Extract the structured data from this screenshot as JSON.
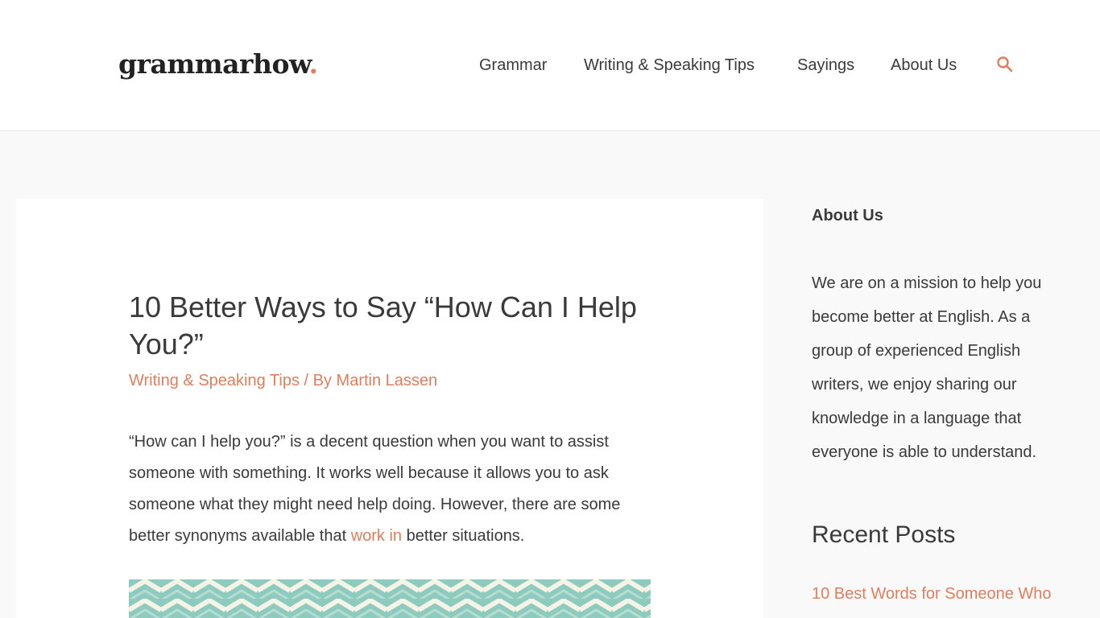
{
  "site": {
    "logo_text": "grammarhow",
    "logo_dot": "."
  },
  "nav": {
    "items": [
      {
        "label": "Grammar"
      },
      {
        "label": "Writing & Speaking Tips"
      },
      {
        "label": "Sayings"
      },
      {
        "label": "About Us"
      }
    ],
    "search_icon": "search-icon"
  },
  "article": {
    "title": "10 Better Ways to Say “How Can I Help You?”",
    "category": "Writing & Speaking Tips",
    "separator_by": " / By ",
    "author": "Martin Lassen",
    "body_before_link": "“How can I help you?” is a decent question when you want to assist someone with something. It works well because it allows you to ask someone what they might need help doing. However, there are some better synonyms available that ",
    "body_link": "work in",
    "body_after_link": " better situations."
  },
  "sidebar": {
    "about_title": "About Us",
    "about_text": "We are on a mission to help you become better at English. As a group of experienced English writers, we enjoy sharing our knowledge in a language that everyone is able to understand.",
    "recent_title": "Recent Posts",
    "recent_posts": [
      {
        "label": "10 Best Words for Someone Who"
      }
    ]
  },
  "colors": {
    "accent": "#e07e5c",
    "text": "#3a3a3a",
    "background": "#f9f9f9",
    "image_teal": "#8ccbbd",
    "image_cream": "#f6f4e6"
  }
}
